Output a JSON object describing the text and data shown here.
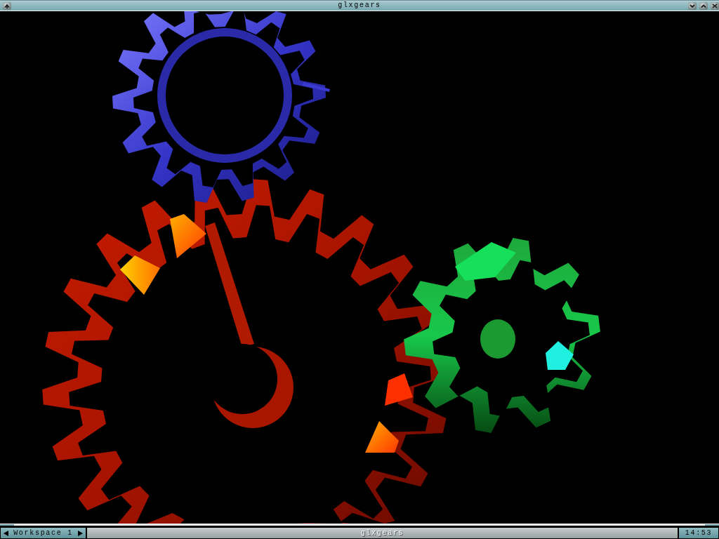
{
  "window": {
    "title": "glxgears"
  },
  "toolbar": {
    "workspace": "Workspace 1",
    "window_label": "glxgears",
    "clock": "14:53"
  }
}
